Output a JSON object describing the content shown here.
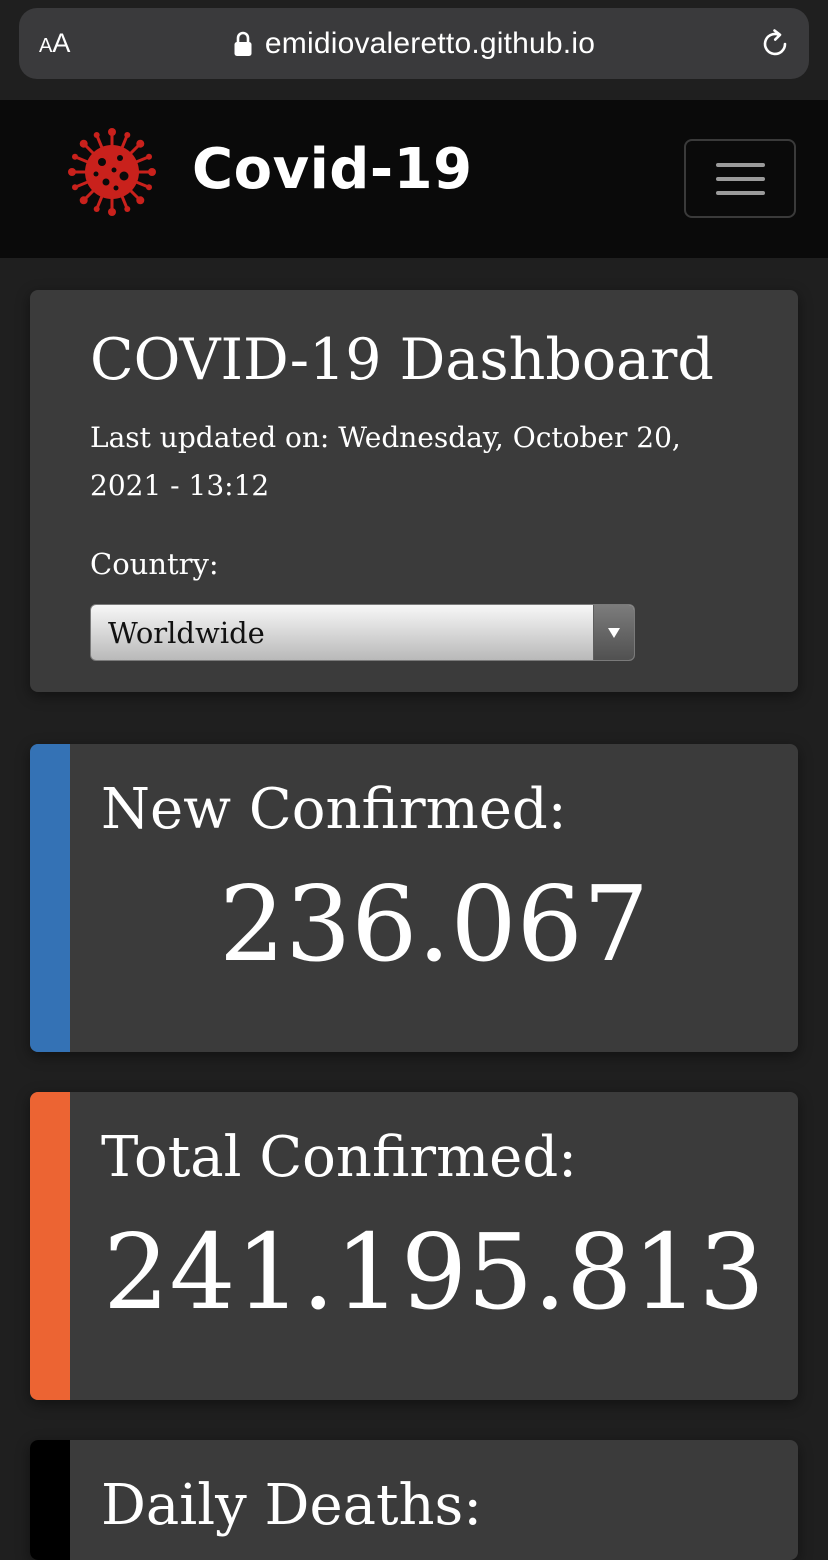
{
  "browser": {
    "aa_small": "A",
    "aa_big": "A",
    "url": "emidiovaleretto.github.io"
  },
  "navbar": {
    "brand": "Covid-19",
    "logo_icon": "virus-icon",
    "menu_icon": "hamburger-menu-icon"
  },
  "dashboard": {
    "title": "COVID-19 Dashboard",
    "last_updated": "Last updated on: Wednesday, October 20, 2021 - 13:12",
    "country_label": "Country:",
    "country_selected": "Worldwide"
  },
  "cards": {
    "new_confirmed": {
      "label": "New Confirmed:",
      "value": "236.067",
      "color": "#3472b5"
    },
    "total_confirmed": {
      "label": "Total Confirmed:",
      "value": "241.195.813",
      "color": "#ec6433"
    },
    "daily_deaths": {
      "label": "Daily Deaths:",
      "color": "#000000"
    }
  },
  "colors": {
    "background": "#1f1f1f",
    "navbar": "#0a0a0a",
    "card": "#3b3b3b",
    "virus_red": "#c9211c"
  }
}
